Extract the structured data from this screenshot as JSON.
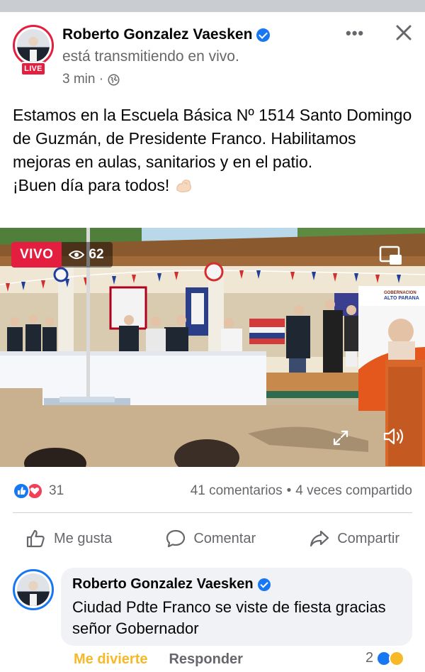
{
  "post": {
    "author": "Roberto Gonzalez Vaesken",
    "status": "está transmitiendo en vivo.",
    "live_badge": "LIVE",
    "time": "3 min ·",
    "more_label": "•••",
    "text_lines": [
      "Estamos en la Escuela Básica Nº 1514 Santo Domingo de Guzmán, de Presidente Franco. Habilitamos mejoras en aulas, sanitarios y en el patio.",
      "¡Buen día para todos!"
    ]
  },
  "video": {
    "live_label": "VIVO",
    "viewers": "62",
    "sign_top": "GOBERNACION",
    "sign_bottom": "ALTO PARANA"
  },
  "reactions": {
    "count": "31",
    "comments": "41 comentarios",
    "separator": "•",
    "shares": "4 veces compartido"
  },
  "actions": {
    "like": "Me gusta",
    "comment": "Comentar",
    "share": "Compartir"
  },
  "comment": {
    "author": "Roberto Gonzalez Vaesken",
    "text": "Ciudad Pdte Franco se viste de fiesta gracias señor Gobernador",
    "reaction_label": "Me divierte",
    "reply_label": "Responder",
    "reaction_count": "2"
  },
  "colors": {
    "live_red": "#e41e3f",
    "facebook_blue": "#1877f2",
    "secondary_text": "#65676b",
    "haha_yellow": "#f7b928"
  }
}
